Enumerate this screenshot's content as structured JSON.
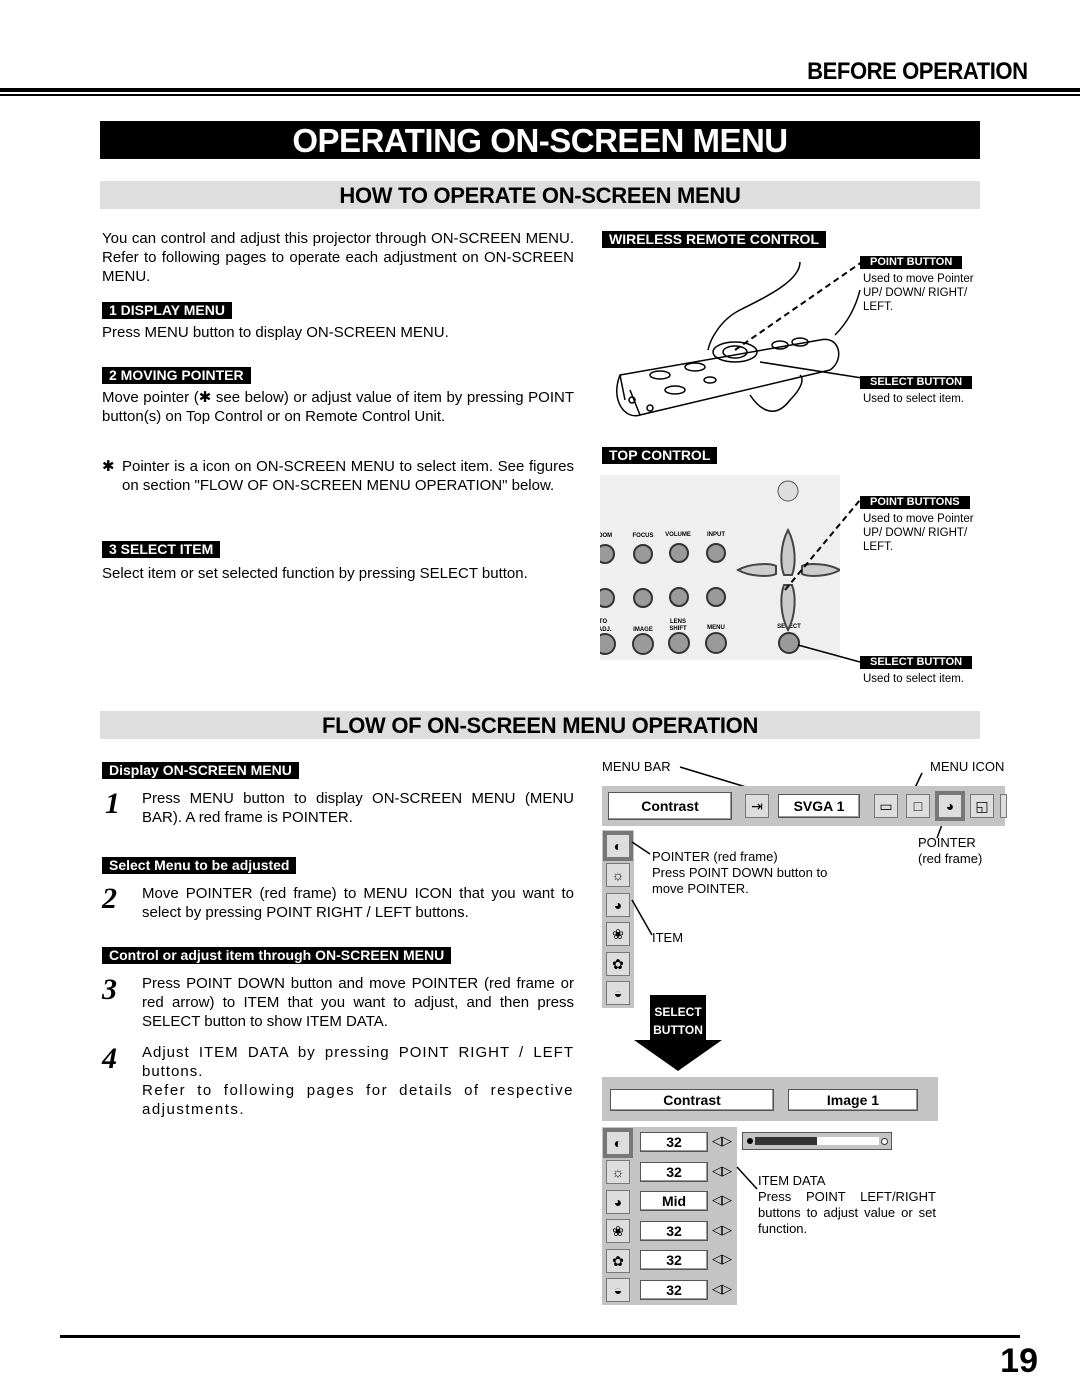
{
  "header": {
    "section": "BEFORE OPERATION"
  },
  "page_title": "OPERATING ON-SCREEN MENU",
  "how_to": {
    "title": "HOW TO OPERATE ON-SCREEN MENU",
    "intro": "You can control and adjust this projector through ON-SCREEN MENU.  Refer to following pages to operate each adjustment on ON-SCREEN MENU.",
    "steps": [
      {
        "label": "1  DISPLAY MENU",
        "text": "Press MENU button to display ON-SCREEN MENU."
      },
      {
        "label": "2  MOVING POINTER",
        "text": "Move pointer (✱ see below) or adjust value of item by pressing POINT button(s) on Top Control or on Remote Control Unit."
      },
      {
        "label": "3  SELECT ITEM",
        "text": "Select item or set selected function by pressing SELECT button."
      }
    ],
    "note_symbol": "✱",
    "note": "Pointer is a icon on ON-SCREEN MENU to select item. See figures on section \"FLOW OF ON-SCREEN MENU OPERATION\" below."
  },
  "remote": {
    "label": "WIRELESS REMOTE CONTROL",
    "point_button": {
      "label": "POINT BUTTON",
      "desc": "Used to move Pointer UP/ DOWN/ RIGHT/ LEFT."
    },
    "select_button": {
      "label": "SELECT BUTTON",
      "desc": "Used to select item."
    }
  },
  "top_control": {
    "label": "TOP CONTROL",
    "button_labels": [
      "OOM",
      "FOCUS",
      "VOLUME",
      "INPUT",
      "TO\n: ADJ.",
      "IMAGE",
      "LENS\nSHIFT",
      "MENU",
      "SELECT"
    ],
    "point_buttons": {
      "label": "POINT BUTTONS",
      "desc": "Used to move Pointer UP/ DOWN/ RIGHT/ LEFT."
    },
    "select_button": {
      "label": "SELECT BUTTON",
      "desc": "Used to select item."
    }
  },
  "flow": {
    "title": "FLOW OF ON-SCREEN MENU OPERATION",
    "groups": [
      {
        "label": "Display ON-SCREEN MENU",
        "steps": [
          {
            "num": "1",
            "text": "Press MENU button to display ON-SCREEN MENU (MENU BAR).  A red frame is POINTER."
          }
        ]
      },
      {
        "label": "Select Menu to be adjusted",
        "steps": [
          {
            "num": "2",
            "text": "Move POINTER (red frame) to MENU ICON that you want to select by pressing POINT RIGHT / LEFT buttons."
          }
        ]
      },
      {
        "label": "Control or adjust item through ON-SCREEN MENU",
        "steps": [
          {
            "num": "3",
            "text": "Press POINT DOWN button and move POINTER (red frame or red arrow) to ITEM that you want to adjust, and then press SELECT button to show ITEM DATA."
          },
          {
            "num": "4",
            "text": "Adjust ITEM DATA by pressing POINT RIGHT / LEFT buttons.",
            "text2": "Refer to following pages for details of respective adjustments."
          }
        ]
      }
    ],
    "diagram": {
      "menu_bar_label": "MENU BAR",
      "menu_icon_label": "MENU ICON",
      "pointer_label": "POINTER\n(red frame)",
      "pointer_item_label": "POINTER (red frame)",
      "pointer_item_desc": "Press POINT DOWN button to move POINTER.",
      "item_label": "ITEM",
      "menubar_item": "Contrast",
      "menubar_source": "SVGA 1",
      "select_arrow": "SELECT\nBUTTON",
      "submenu_item": "Contrast",
      "submenu_mode": "Image 1",
      "item_values": [
        "32",
        "32",
        "Mid",
        "32",
        "32",
        "32"
      ],
      "slider_fraction": 0.5,
      "item_data_label": "ITEM DATA",
      "item_data_desc": "Press POINT LEFT/RIGHT buttons to adjust value or set function."
    }
  },
  "page_number": "19"
}
